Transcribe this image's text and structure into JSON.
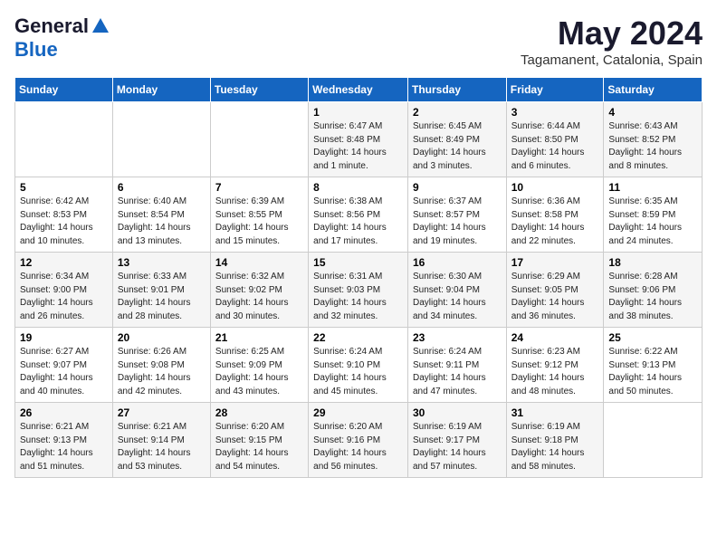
{
  "logo": {
    "general": "General",
    "blue": "Blue"
  },
  "title": "May 2024",
  "location": "Tagamanent, Catalonia, Spain",
  "weekdays": [
    "Sunday",
    "Monday",
    "Tuesday",
    "Wednesday",
    "Thursday",
    "Friday",
    "Saturday"
  ],
  "weeks": [
    [
      {
        "day": "",
        "info": ""
      },
      {
        "day": "",
        "info": ""
      },
      {
        "day": "",
        "info": ""
      },
      {
        "day": "1",
        "info": "Sunrise: 6:47 AM\nSunset: 8:48 PM\nDaylight: 14 hours\nand 1 minute."
      },
      {
        "day": "2",
        "info": "Sunrise: 6:45 AM\nSunset: 8:49 PM\nDaylight: 14 hours\nand 3 minutes."
      },
      {
        "day": "3",
        "info": "Sunrise: 6:44 AM\nSunset: 8:50 PM\nDaylight: 14 hours\nand 6 minutes."
      },
      {
        "day": "4",
        "info": "Sunrise: 6:43 AM\nSunset: 8:52 PM\nDaylight: 14 hours\nand 8 minutes."
      }
    ],
    [
      {
        "day": "5",
        "info": "Sunrise: 6:42 AM\nSunset: 8:53 PM\nDaylight: 14 hours\nand 10 minutes."
      },
      {
        "day": "6",
        "info": "Sunrise: 6:40 AM\nSunset: 8:54 PM\nDaylight: 14 hours\nand 13 minutes."
      },
      {
        "day": "7",
        "info": "Sunrise: 6:39 AM\nSunset: 8:55 PM\nDaylight: 14 hours\nand 15 minutes."
      },
      {
        "day": "8",
        "info": "Sunrise: 6:38 AM\nSunset: 8:56 PM\nDaylight: 14 hours\nand 17 minutes."
      },
      {
        "day": "9",
        "info": "Sunrise: 6:37 AM\nSunset: 8:57 PM\nDaylight: 14 hours\nand 19 minutes."
      },
      {
        "day": "10",
        "info": "Sunrise: 6:36 AM\nSunset: 8:58 PM\nDaylight: 14 hours\nand 22 minutes."
      },
      {
        "day": "11",
        "info": "Sunrise: 6:35 AM\nSunset: 8:59 PM\nDaylight: 14 hours\nand 24 minutes."
      }
    ],
    [
      {
        "day": "12",
        "info": "Sunrise: 6:34 AM\nSunset: 9:00 PM\nDaylight: 14 hours\nand 26 minutes."
      },
      {
        "day": "13",
        "info": "Sunrise: 6:33 AM\nSunset: 9:01 PM\nDaylight: 14 hours\nand 28 minutes."
      },
      {
        "day": "14",
        "info": "Sunrise: 6:32 AM\nSunset: 9:02 PM\nDaylight: 14 hours\nand 30 minutes."
      },
      {
        "day": "15",
        "info": "Sunrise: 6:31 AM\nSunset: 9:03 PM\nDaylight: 14 hours\nand 32 minutes."
      },
      {
        "day": "16",
        "info": "Sunrise: 6:30 AM\nSunset: 9:04 PM\nDaylight: 14 hours\nand 34 minutes."
      },
      {
        "day": "17",
        "info": "Sunrise: 6:29 AM\nSunset: 9:05 PM\nDaylight: 14 hours\nand 36 minutes."
      },
      {
        "day": "18",
        "info": "Sunrise: 6:28 AM\nSunset: 9:06 PM\nDaylight: 14 hours\nand 38 minutes."
      }
    ],
    [
      {
        "day": "19",
        "info": "Sunrise: 6:27 AM\nSunset: 9:07 PM\nDaylight: 14 hours\nand 40 minutes."
      },
      {
        "day": "20",
        "info": "Sunrise: 6:26 AM\nSunset: 9:08 PM\nDaylight: 14 hours\nand 42 minutes."
      },
      {
        "day": "21",
        "info": "Sunrise: 6:25 AM\nSunset: 9:09 PM\nDaylight: 14 hours\nand 43 minutes."
      },
      {
        "day": "22",
        "info": "Sunrise: 6:24 AM\nSunset: 9:10 PM\nDaylight: 14 hours\nand 45 minutes."
      },
      {
        "day": "23",
        "info": "Sunrise: 6:24 AM\nSunset: 9:11 PM\nDaylight: 14 hours\nand 47 minutes."
      },
      {
        "day": "24",
        "info": "Sunrise: 6:23 AM\nSunset: 9:12 PM\nDaylight: 14 hours\nand 48 minutes."
      },
      {
        "day": "25",
        "info": "Sunrise: 6:22 AM\nSunset: 9:13 PM\nDaylight: 14 hours\nand 50 minutes."
      }
    ],
    [
      {
        "day": "26",
        "info": "Sunrise: 6:21 AM\nSunset: 9:13 PM\nDaylight: 14 hours\nand 51 minutes."
      },
      {
        "day": "27",
        "info": "Sunrise: 6:21 AM\nSunset: 9:14 PM\nDaylight: 14 hours\nand 53 minutes."
      },
      {
        "day": "28",
        "info": "Sunrise: 6:20 AM\nSunset: 9:15 PM\nDaylight: 14 hours\nand 54 minutes."
      },
      {
        "day": "29",
        "info": "Sunrise: 6:20 AM\nSunset: 9:16 PM\nDaylight: 14 hours\nand 56 minutes."
      },
      {
        "day": "30",
        "info": "Sunrise: 6:19 AM\nSunset: 9:17 PM\nDaylight: 14 hours\nand 57 minutes."
      },
      {
        "day": "31",
        "info": "Sunrise: 6:19 AM\nSunset: 9:18 PM\nDaylight: 14 hours\nand 58 minutes."
      },
      {
        "day": "",
        "info": ""
      }
    ]
  ]
}
